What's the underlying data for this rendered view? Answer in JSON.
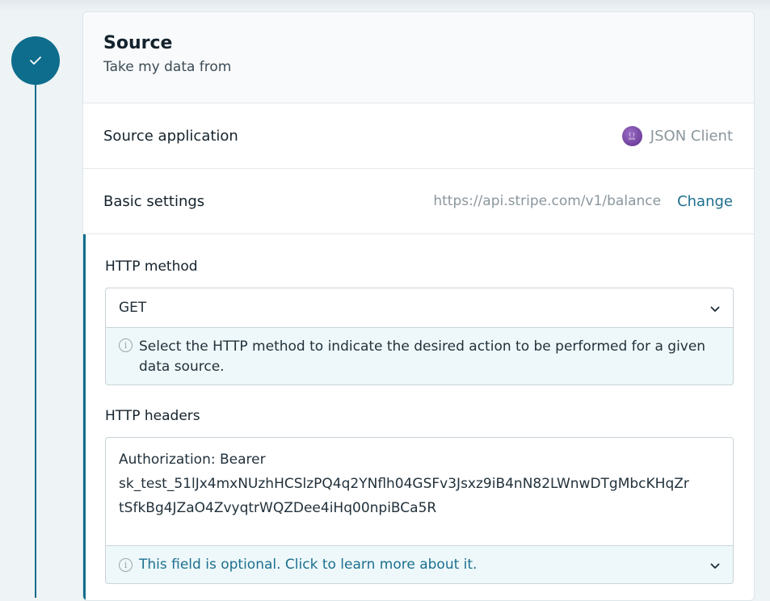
{
  "step": {
    "status_icon": "checkmark-icon"
  },
  "source": {
    "title": "Source",
    "subtitle": "Take my data from"
  },
  "source_application": {
    "label": "Source application",
    "app_name": "JSON Client",
    "app_icon": "json-client-logo"
  },
  "basic_settings": {
    "label": "Basic settings",
    "url": "https://api.stripe.com/v1/balance",
    "change_label": "Change"
  },
  "http_method": {
    "label": "HTTP method",
    "value": "GET",
    "hint": "Select the HTTP method to indicate the desired action to be performed for a given data source."
  },
  "http_headers": {
    "label": "HTTP headers",
    "value": "Authorization: Bearer\nsk_test_51lJx4mxNUzhHCSlzPQ4q2YNflh04GSFv3Jsxz9iB4nN82LWnwDTgMbcKHqZrtSfkBg4JZaO4ZvyqtrWQZDee4iHq00npiBCa5R",
    "optional_hint": "This field is optional. Click to learn more about it."
  },
  "colors": {
    "accent": "#0e6d8c",
    "link": "#1d6f8f",
    "hint_background": "#eef8fa"
  }
}
